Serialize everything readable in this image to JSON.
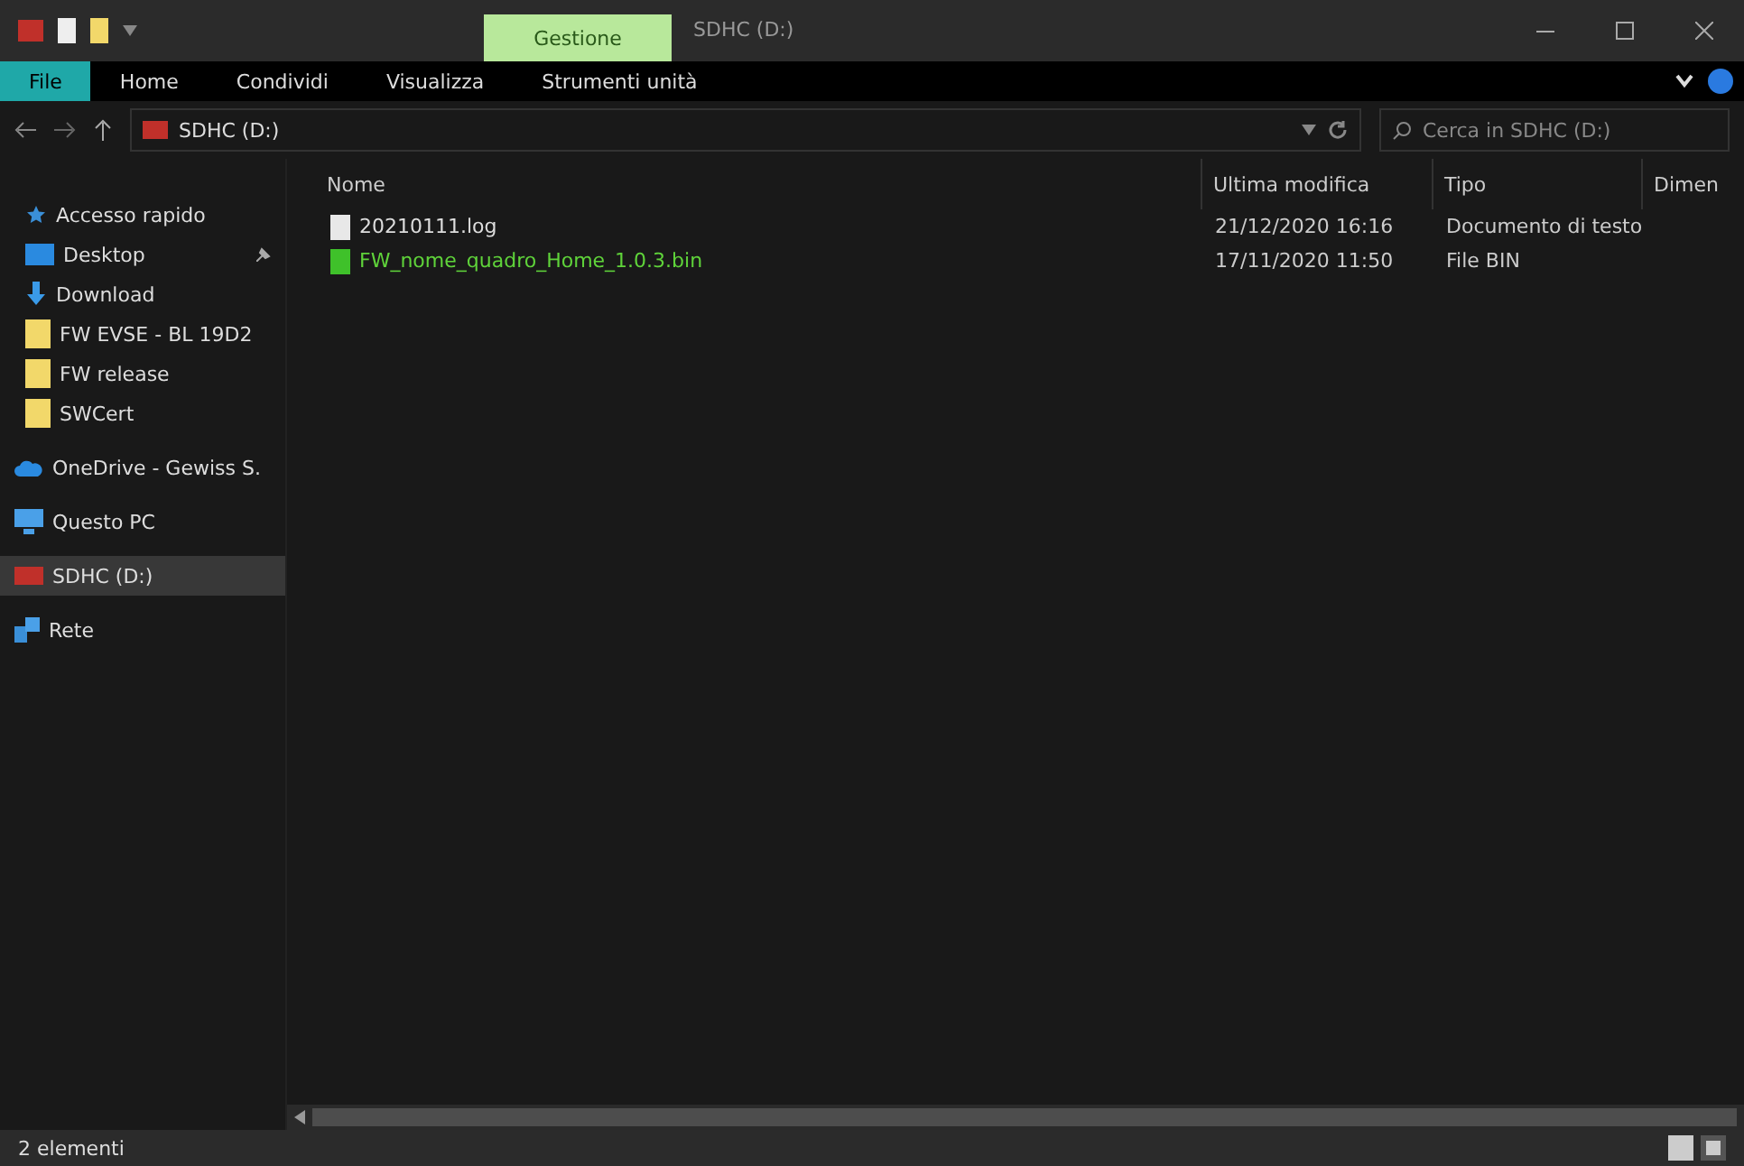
{
  "window": {
    "title": "SDHC (D:)",
    "context_tab": "Gestione"
  },
  "ribbon_tabs": [
    {
      "label": "File",
      "selected": true
    },
    {
      "label": "Home",
      "selected": false
    },
    {
      "label": "Condividi",
      "selected": false
    },
    {
      "label": "Visualizza",
      "selected": false
    },
    {
      "label": "Strumenti unità",
      "selected": false
    }
  ],
  "address": {
    "path": "SDHC (D:)"
  },
  "search": {
    "placeholder": "Cerca in SDHC (D:)"
  },
  "sidebar": {
    "items": [
      {
        "label": "Accesso rapido",
        "kind": "star",
        "selected": false,
        "pinned": false
      },
      {
        "label": "Desktop",
        "kind": "desktop",
        "selected": false,
        "pinned": true
      },
      {
        "label": "Download",
        "kind": "download",
        "selected": false,
        "pinned": false
      },
      {
        "label": "FW EVSE - BL 19D2",
        "kind": "folder",
        "selected": false,
        "pinned": false
      },
      {
        "label": "FW release",
        "kind": "folder",
        "selected": false,
        "pinned": false
      },
      {
        "label": "SWCert",
        "kind": "folder",
        "selected": false,
        "pinned": false
      },
      {
        "label": "OneDrive - Gewiss S.",
        "kind": "cloud",
        "selected": false,
        "pinned": false
      },
      {
        "label": "Questo PC",
        "kind": "pc",
        "selected": false,
        "pinned": false
      },
      {
        "label": "SDHC (D:)",
        "kind": "drive",
        "selected": true,
        "pinned": false
      },
      {
        "label": "Rete",
        "kind": "network",
        "selected": false,
        "pinned": false
      }
    ]
  },
  "table": {
    "columns": [
      "Nome",
      "Ultima modifica",
      "Tipo",
      "Dimen"
    ],
    "rows": [
      {
        "name": "20210111.log",
        "modified": "21/12/2020 16:16",
        "type": "Documento di testo",
        "kind": "text",
        "highlighted": false
      },
      {
        "name": "FW_nome_quadro_Home_1.0.3.bin",
        "modified": "17/11/2020 11:50",
        "type": "File BIN",
        "kind": "bin",
        "highlighted": true
      }
    ]
  },
  "status_bar": {
    "count": "2 elementi"
  }
}
